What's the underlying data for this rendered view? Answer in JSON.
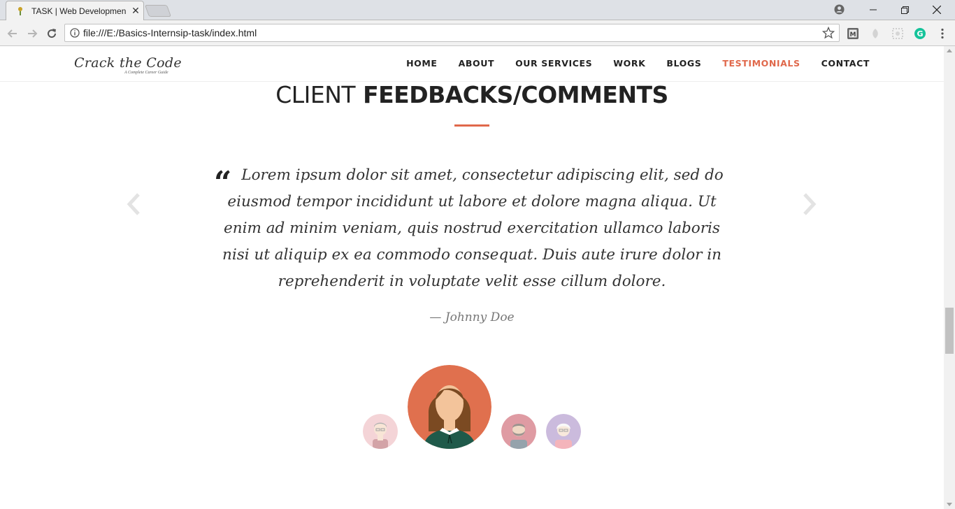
{
  "browser": {
    "tab_title": "TASK | Web Developmen",
    "url": "file:///E:/Basics-Internsip-task/index.html"
  },
  "site": {
    "logo_text": "Crack the Code",
    "logo_subtitle": "A Complete Career Guide",
    "nav": [
      {
        "label": "HOME"
      },
      {
        "label": "ABOUT"
      },
      {
        "label": "OUR SERVICES"
      },
      {
        "label": "WORK"
      },
      {
        "label": "BLOGS"
      },
      {
        "label": "TESTIMONIALS",
        "active": true
      },
      {
        "label": "CONTACT"
      }
    ],
    "accent_color": "#e0684b"
  },
  "testimonials": {
    "title_light": "CLIENT",
    "title_bold": "FEEDBACKS/COMMENTS",
    "quote": "Lorem ipsum dolor sit amet, consectetur adipiscing elit, sed do eiusmod tempor incididunt ut labore et dolore magna aliqua. Ut enim ad minim veniam, quis nostrud exercitation ullamco laboris nisi ut aliquip ex ea commodo consequat. Duis aute irure dolor in reprehenderit in voluptate velit esse cillum dolore.",
    "author": "— Johnny Doe",
    "avatars": [
      {
        "name": "avatar-man-glasses",
        "active": false
      },
      {
        "name": "avatar-woman-brown-hair",
        "active": true
      },
      {
        "name": "avatar-man-beard",
        "active": false
      },
      {
        "name": "avatar-woman-glasses",
        "active": false
      }
    ]
  }
}
